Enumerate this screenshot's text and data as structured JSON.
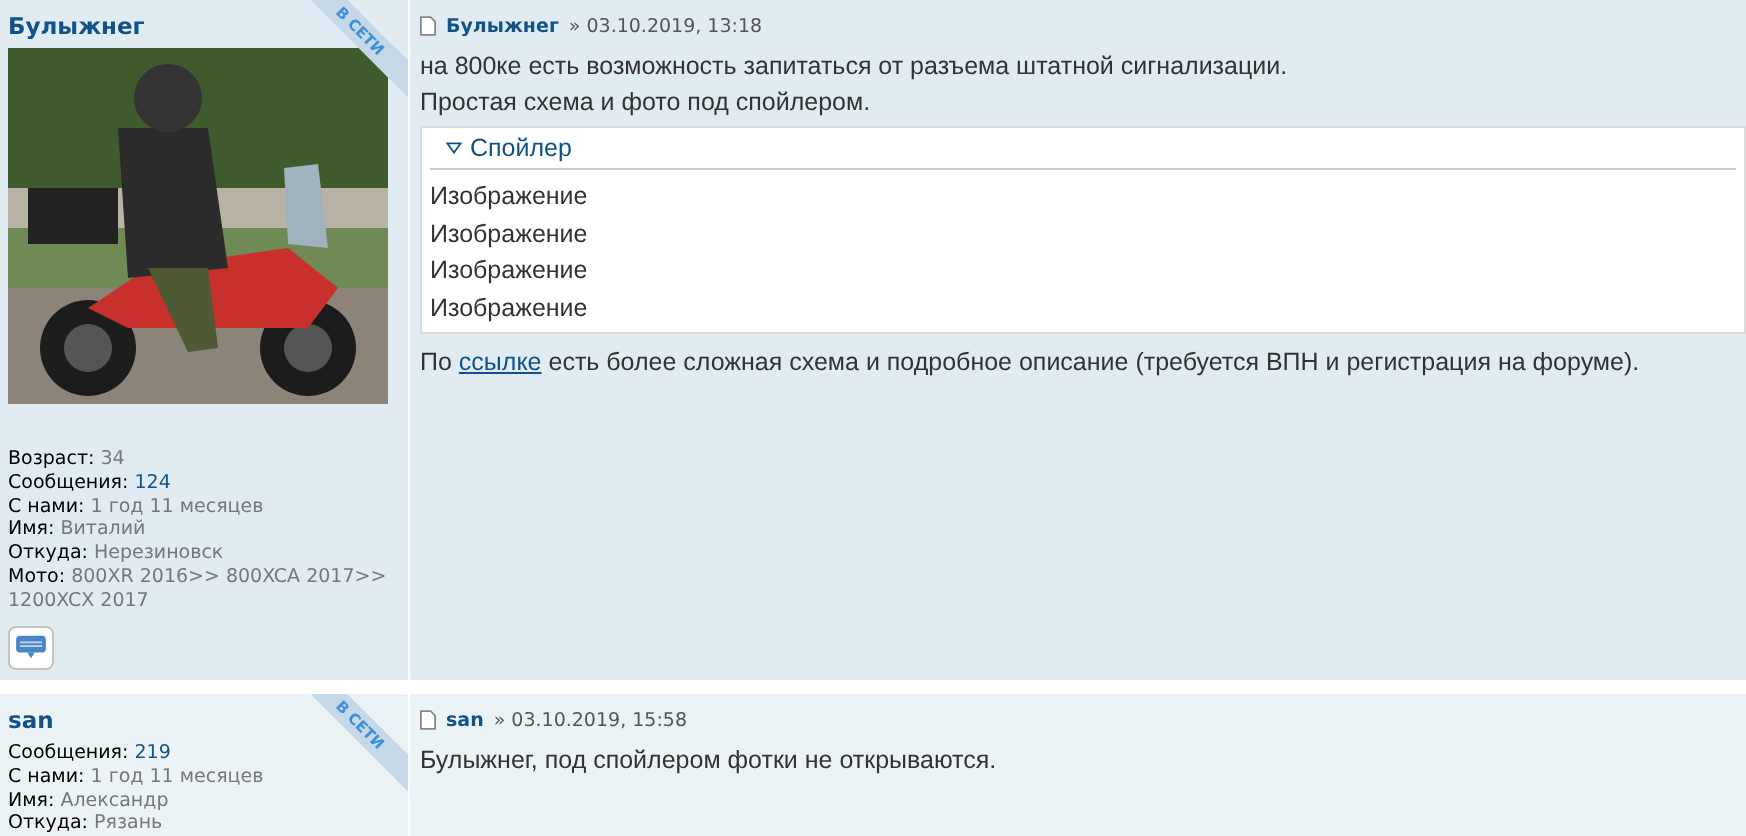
{
  "posts": [
    {
      "author": "Булыжнег",
      "online": true,
      "ribbon": "В СЕТИ",
      "profile": [
        {
          "label": "Возраст:",
          "value": "34",
          "kind": "text"
        },
        {
          "label": "Сообщения:",
          "value": "124",
          "kind": "link"
        },
        {
          "label": "С нами:",
          "value": "1 год 11 месяцев",
          "kind": "text"
        },
        {
          "label": "Имя:",
          "value": "Виталий",
          "kind": "text"
        },
        {
          "label": "Откуда:",
          "value": "Нерезиновск",
          "kind": "text"
        },
        {
          "label": "Мото:",
          "value": "800XR 2016>> 800XCA 2017>> 1200XCX 2017",
          "kind": "text"
        }
      ],
      "contact_button": true,
      "header": {
        "author": "Булыжнег",
        "date": "» 03.10.2019, 13:18"
      },
      "body": [
        {
          "kind": "text",
          "text": "на 800ке есть возможность запитаться от разъема штатной сигнализации."
        },
        {
          "kind": "text",
          "text": "Простая схема и фото под спойлером."
        },
        {
          "kind": "spoiler",
          "title": "Спойлер",
          "expanded": true,
          "items": [
            "Изображение",
            "Изображение",
            "Изображение",
            "Изображение"
          ]
        },
        {
          "kind": "parts",
          "parts": [
            {
              "text": "По ",
              "kind": "text"
            },
            {
              "text": "ссылке",
              "kind": "link"
            },
            {
              "text": " есть более сложная схема и подробное описание (требуется ВПН и регистрация на форуме).",
              "kind": "text"
            }
          ]
        }
      ]
    },
    {
      "author": "san",
      "online": true,
      "ribbon": "В СЕТИ",
      "profile": [
        {
          "label": "Сообщения:",
          "value": "219",
          "kind": "link"
        },
        {
          "label": "С нами:",
          "value": "1 год 11 месяцев",
          "kind": "text"
        },
        {
          "label": "Имя:",
          "value": "Александр",
          "kind": "text"
        },
        {
          "label": "Откуда:",
          "value": "Рязань",
          "kind": "text"
        }
      ],
      "contact_button": false,
      "header": {
        "author": "san",
        "date": "» 03.10.2019, 15:58"
      },
      "body": [
        {
          "kind": "text",
          "text": "Булыжнег, под спойлером фотки не открываются."
        }
      ]
    }
  ]
}
